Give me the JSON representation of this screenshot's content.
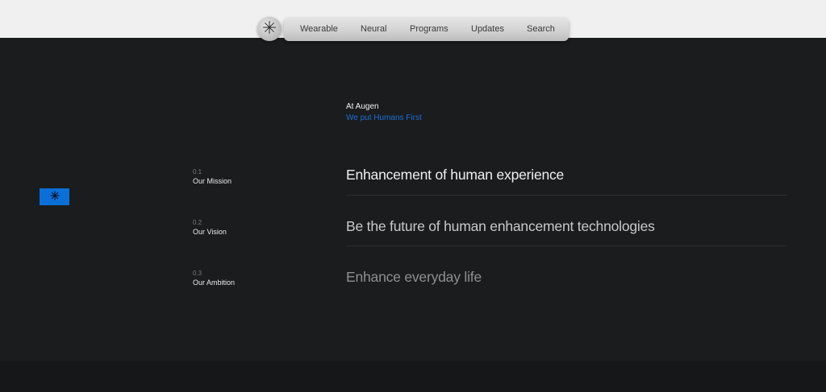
{
  "nav": {
    "logo_icon": "asterisk-logo-icon",
    "items": [
      {
        "label": "Wearable"
      },
      {
        "label": "Neural"
      },
      {
        "label": "Programs"
      },
      {
        "label": "Updates"
      },
      {
        "label": "Search"
      }
    ]
  },
  "intro": {
    "title": "At Augen",
    "subtitle": "We put Humans First"
  },
  "badge": {
    "icon": "asterisk-icon"
  },
  "rows": [
    {
      "number": "0.1",
      "label": "Our Mission",
      "statement": "Enhancement of human experience"
    },
    {
      "number": "0.2",
      "label": "Our Vision",
      "statement": "Be the future of human enhancement technologies"
    },
    {
      "number": "0.3",
      "label": "Our Ambition",
      "statement": "Enhance everyday life"
    }
  ],
  "colors": {
    "accent": "#0b6fd8",
    "background": "#1b1c1e",
    "top_strip": "#f0f0f0",
    "text_primary": "#f2f2f2",
    "text_muted": "#9a9a9a"
  }
}
